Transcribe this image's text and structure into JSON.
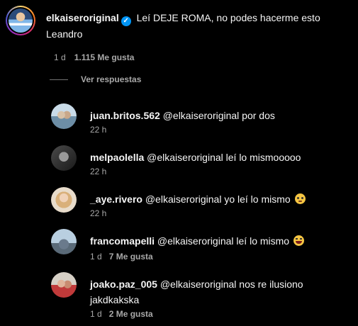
{
  "main_comment": {
    "username": "elkaiseroriginal",
    "verified_icon": "✓",
    "text": "Leí DEJE ROMA, no podes hacerme esto Leandro",
    "time": "1 d",
    "likes": "1.115 Me gusta"
  },
  "view_replies": "Ver respuestas",
  "replies": [
    {
      "username": "juan.britos.562",
      "text": "@elkaiseroriginal por dos",
      "time": "22 h",
      "likes": ""
    },
    {
      "username": "melpaolella",
      "text": "@elkaiseroriginal leí lo mismooooo",
      "time": "22 h",
      "likes": ""
    },
    {
      "username": "_aye.rivero",
      "text": "@elkaiseroriginal yo leí lo mismo",
      "emoji": "flushed-face",
      "time": "22 h",
      "likes": ""
    },
    {
      "username": "francomapelli",
      "text": "@elkaiseroriginal leí lo mismo",
      "emoji": "laughing-face",
      "time": "1 d",
      "likes": "7 Me gusta"
    },
    {
      "username": "joako.paz_005",
      "text": "@elkaiseroriginal nos re ilusiono jakdkakska",
      "time": "1 d",
      "likes": "2 Me gusta"
    }
  ],
  "colors": {
    "background": "#000000",
    "text": "#f5f5f5",
    "secondary": "#a8a8a8",
    "verified": "#0095f6"
  }
}
